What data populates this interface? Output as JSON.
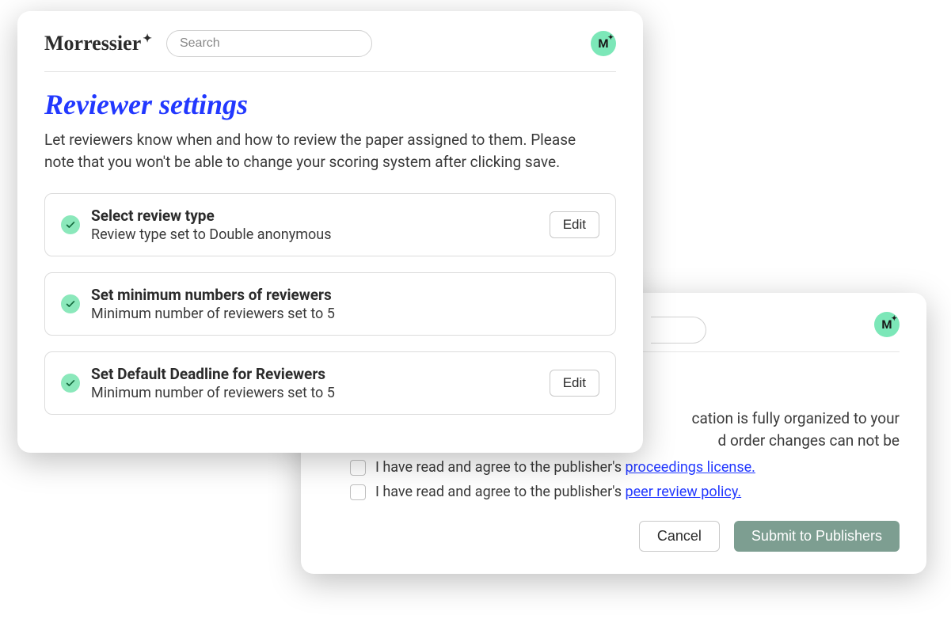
{
  "brand": "Morressier",
  "search_placeholder": "Search",
  "avatar_initial": "M",
  "front": {
    "title": "Reviewer settings",
    "subtitle": "Let reviewers know when and how to review the paper assigned to them. Please note that you won't be able to change your scoring system after clicking save.",
    "edit_label": "Edit",
    "settings": [
      {
        "title": "Select review type",
        "detail": "Review type set to Double anonymous",
        "has_edit": true
      },
      {
        "title": "Set minimum numbers of reviewers",
        "detail": "Minimum number of reviewers set to 5",
        "has_edit": false
      },
      {
        "title": "Set Default Deadline for Reviewers",
        "detail": "Minimum number of reviewers set to 5",
        "has_edit": true
      }
    ]
  },
  "back": {
    "body_line1": "cation is fully organized to your",
    "body_line2": "d order changes can not be",
    "agree_prefix": "I have read and agree to the publisher's ",
    "link1": "proceedings license.",
    "link2": "peer review policy.",
    "cancel": "Cancel",
    "submit": "Submit to Publishers"
  }
}
